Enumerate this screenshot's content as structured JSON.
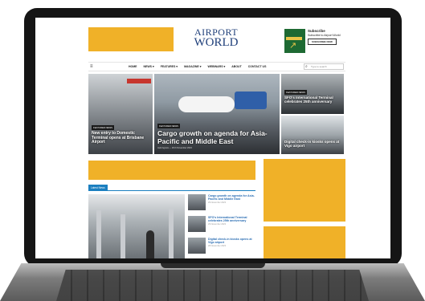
{
  "site": {
    "logo_line1": "AIRPORT",
    "logo_line2": "WORLD",
    "logo_tagline": "",
    "subscribe": {
      "title": "Subscribe",
      "text": "Subscribe to Airport World",
      "button": "SUBSCRIBE NOW",
      "cover_text": "AIRPORT"
    }
  },
  "nav": {
    "menu_icon": "≡",
    "items": [
      "HOME",
      "NEWS ▾",
      "FEATURES ▾",
      "MAGAZINE ▾",
      "WEBINARS ▾",
      "ABOUT",
      "CONTACT US"
    ],
    "search_placeholder": "Type to search",
    "search_icon": "search-icon"
  },
  "hero": {
    "left": {
      "category": "FEATURED NEWS",
      "headline": "New entry to Domestic Terminal opens at Brisbane Airport"
    },
    "main": {
      "category": "FEATURED NEWS",
      "headline": "Cargo growth on agenda for Asia-Pacific and Middle East",
      "meta": "Jack Agnew  —  29 th November 2023"
    },
    "right_top": {
      "category": "FEATURED NEWS",
      "headline": "SFO's International Terminal celebrates 25th anniversary"
    },
    "right_bottom": {
      "headline": "Digital check-in kiosks opens at Vigo airport"
    }
  },
  "latest": {
    "label": "Latest News",
    "items": [
      {
        "title": "Cargo growth on agenda for Asia-Pacific and Middle East",
        "date": "29 November 2023"
      },
      {
        "title": "SFO's International Terminal celebrates 25th anniversary",
        "date": "29 November 2023"
      },
      {
        "title": "Digital check-in kiosks opens at Vigo airport",
        "date": "28 November 2023"
      }
    ]
  },
  "colors": {
    "ad_yellow": "#f0b128",
    "brand_blue": "#1f3f7a",
    "link_blue": "#2a6db3",
    "section_blue": "#1b7fc0"
  }
}
